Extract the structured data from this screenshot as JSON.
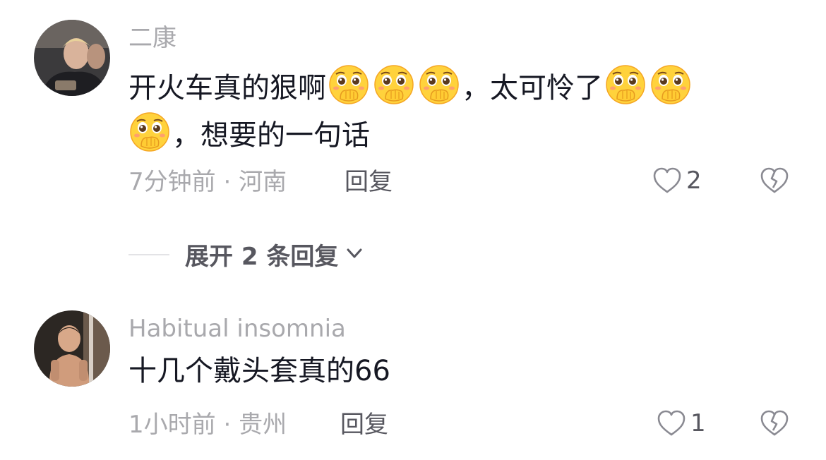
{
  "comments": [
    {
      "username": "二康",
      "text_part1": "开火车真的狠啊",
      "text_part2": "，太可怜了",
      "text_part3": "，想要的一句话",
      "emoji_name": "hand-over-mouth-emoji",
      "time": "7分钟前",
      "separator": "·",
      "location": "河南",
      "reply_label": "回复",
      "likes": "2"
    },
    {
      "username": "Habitual insomnia",
      "text": "十几个戴头套真的66",
      "time": "1小时前",
      "separator": "·",
      "location": "贵州",
      "reply_label": "回复",
      "likes": "1"
    }
  ],
  "expand_replies": {
    "label": "展开 2 条回复"
  },
  "colors": {
    "text": "#161823",
    "muted": "#a9a9ad",
    "secondary": "#57575f",
    "emoji": "#ffd23c"
  }
}
